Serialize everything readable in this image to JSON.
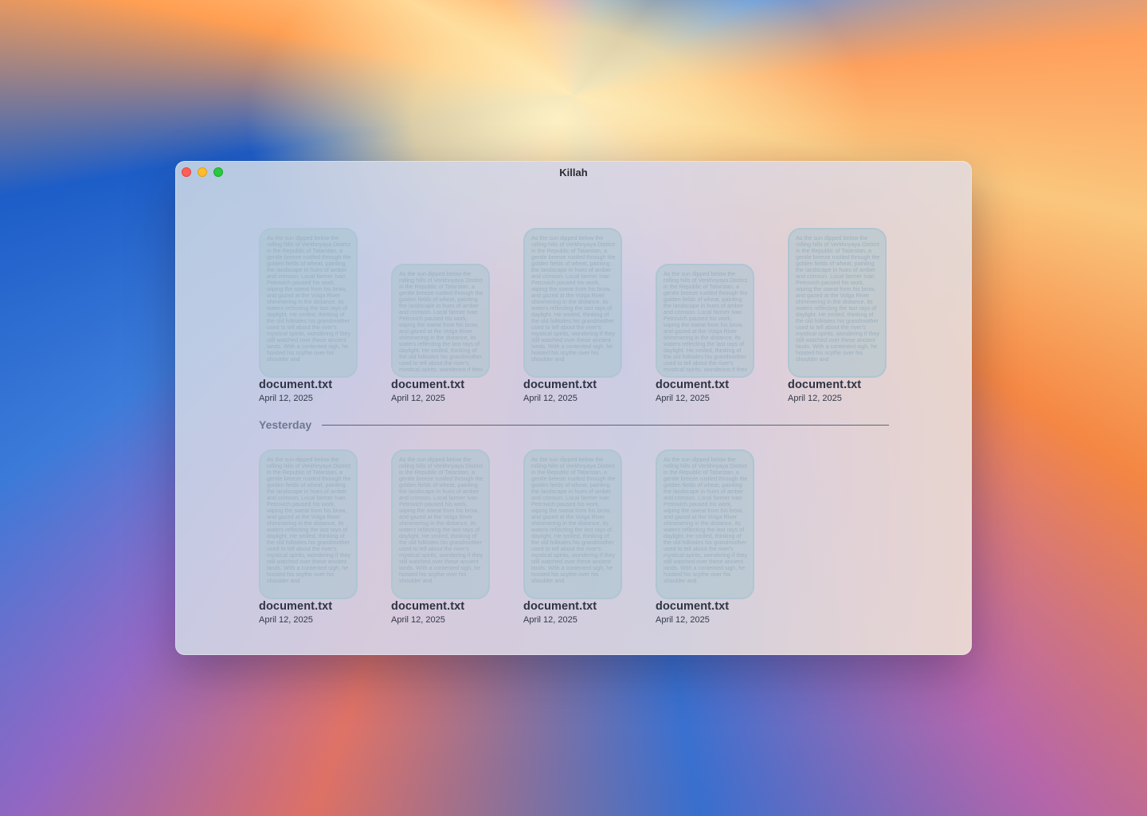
{
  "window": {
    "title": "Killah"
  },
  "preview_text": "As the sun dipped below the rolling hills of Verkhnyaya District in the Republic of Tatarstan, a gentle breeze rustled through the golden fields of wheat, painting the landscape in hues of amber and crimson. Local farmer Ivan Petrovich paused his work, wiping the sweat from his brow, and gazed at the Volga River shimmering in the distance, its waters reflecting the last rays of daylight. He smiled, thinking of the old folktales his grandmother used to tell about the river's mystical spirits, wondering if they still watched over these ancient lands. With a contented sigh, he hoisted his scythe over his shoulder and",
  "sections": [
    {
      "label": "",
      "files": [
        {
          "name": "document.txt",
          "date": "April 12, 2025"
        },
        {
          "name": "document.txt",
          "date": "April 12, 2025"
        },
        {
          "name": "document.txt",
          "date": "April 12, 2025"
        },
        {
          "name": "document.txt",
          "date": "April 12, 2025"
        },
        {
          "name": "document.txt",
          "date": "April 12, 2025"
        }
      ]
    },
    {
      "label": "Yesterday",
      "files": [
        {
          "name": "document.txt",
          "date": "April 12, 2025"
        },
        {
          "name": "document.txt",
          "date": "April 12, 2025"
        },
        {
          "name": "document.txt",
          "date": "April 12, 2025"
        },
        {
          "name": "document.txt",
          "date": "April 12, 2025"
        }
      ]
    }
  ],
  "colors": {
    "close": "#fe5f57",
    "minimize": "#febc2e",
    "zoom": "#28c840"
  }
}
